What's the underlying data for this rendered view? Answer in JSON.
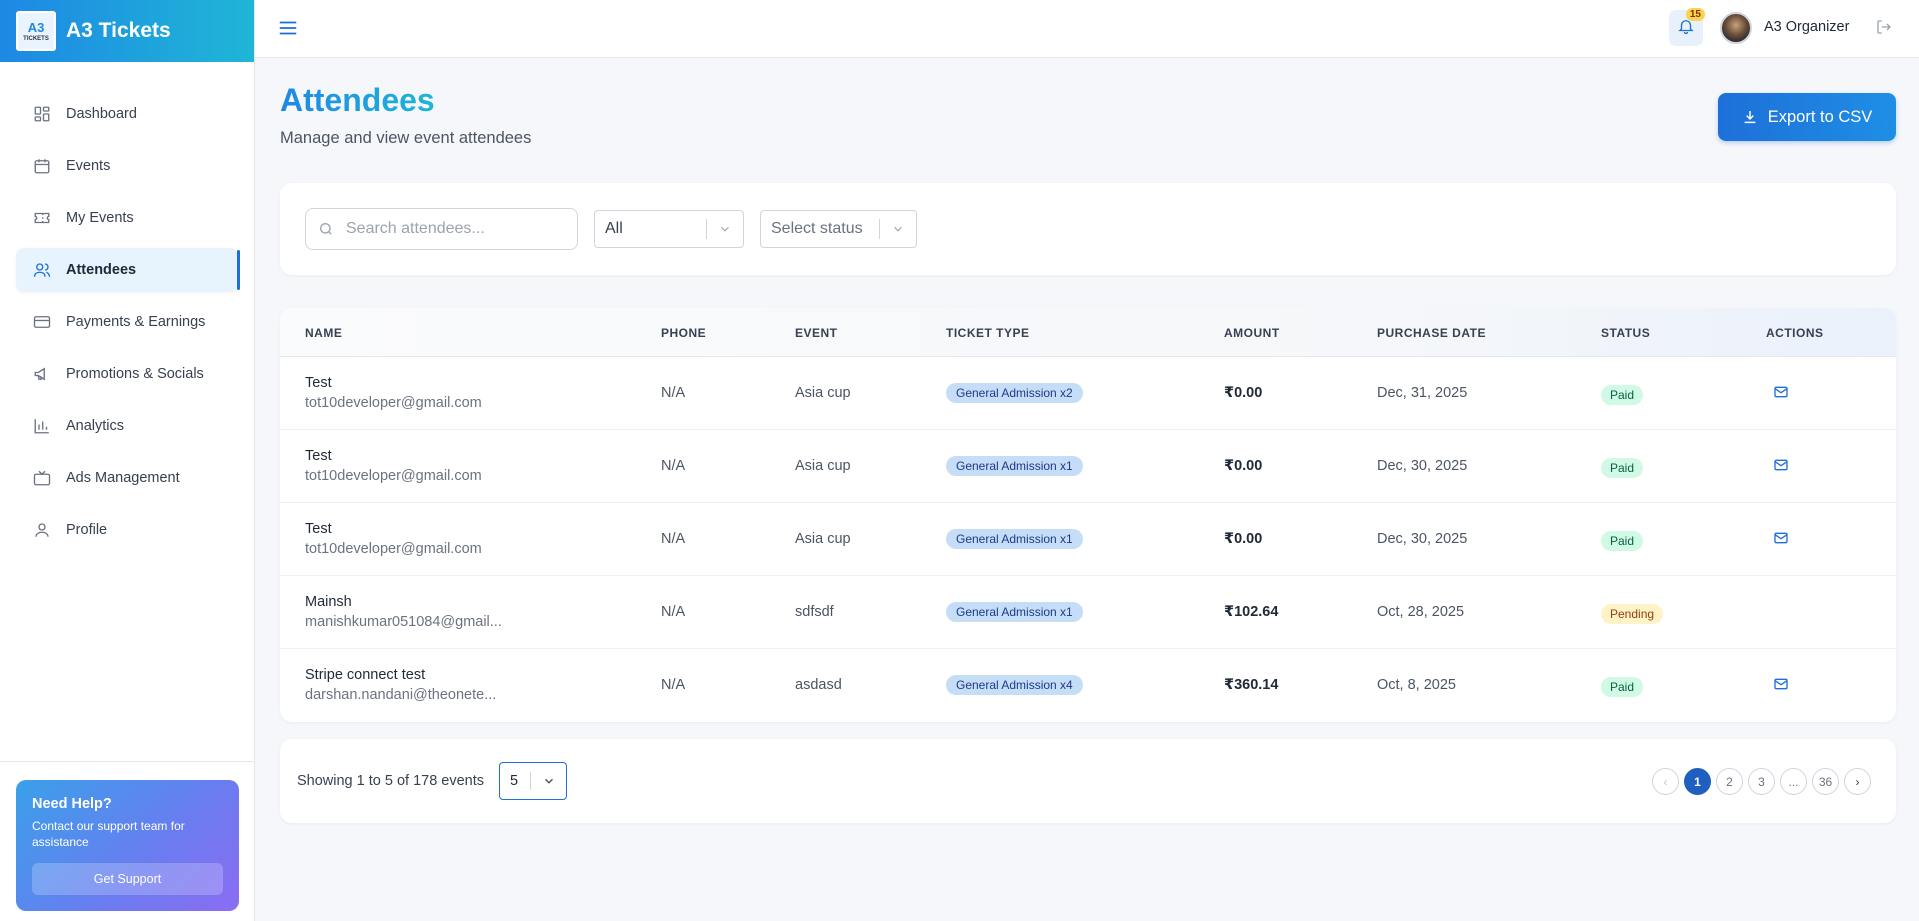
{
  "brand": {
    "title": "A3 Tickets",
    "logo_text": "A3",
    "logo_small": "TICKETS"
  },
  "sidebar": {
    "items": [
      {
        "label": "Dashboard",
        "icon": "dashboard-icon"
      },
      {
        "label": "Events",
        "icon": "calendar-icon"
      },
      {
        "label": "My Events",
        "icon": "ticket-icon"
      },
      {
        "label": "Attendees",
        "icon": "users-icon",
        "active": true
      },
      {
        "label": "Payments & Earnings",
        "icon": "credit-card-icon"
      },
      {
        "label": "Promotions & Socials",
        "icon": "megaphone-icon"
      },
      {
        "label": "Analytics",
        "icon": "bar-chart-icon"
      },
      {
        "label": "Ads Management",
        "icon": "tv-icon"
      },
      {
        "label": "Profile",
        "icon": "user-icon"
      }
    ],
    "help": {
      "title": "Need Help?",
      "text": "Contact our support team for assistance",
      "button": "Get Support"
    }
  },
  "topbar": {
    "notification_count": "15",
    "user_name": "A3 Organizer"
  },
  "page": {
    "title": "Attendees",
    "subtitle": "Manage and view event attendees",
    "export_label": "Export to CSV"
  },
  "filters": {
    "search_placeholder": "Search attendees...",
    "type_value": "All",
    "status_placeholder": "Select status"
  },
  "table": {
    "headers": {
      "name": "NAME",
      "phone": "PHONE",
      "event": "EVENT",
      "ticket_type": "TICKET TYPE",
      "amount": "AMOUNT",
      "purchase_date": "PURCHASE DATE",
      "status": "STATUS",
      "actions": "ACTIONS"
    },
    "rows": [
      {
        "name": "Test",
        "email": "tot10developer@gmail.com",
        "phone": "N/A",
        "event": "Asia cup",
        "ticket": "General Admission x2",
        "amount": "₹0.00",
        "date": "Dec, 31, 2025",
        "status": "Paid",
        "mail": true
      },
      {
        "name": "Test",
        "email": "tot10developer@gmail.com",
        "phone": "N/A",
        "event": "Asia cup",
        "ticket": "General Admission x1",
        "amount": "₹0.00",
        "date": "Dec, 30, 2025",
        "status": "Paid",
        "mail": true
      },
      {
        "name": "Test",
        "email": "tot10developer@gmail.com",
        "phone": "N/A",
        "event": "Asia cup",
        "ticket": "General Admission x1",
        "amount": "₹0.00",
        "date": "Dec, 30, 2025",
        "status": "Paid",
        "mail": true
      },
      {
        "name": "Mainsh",
        "email": "manishkumar051084@gmail...",
        "phone": "N/A",
        "event": "sdfsdf",
        "ticket": "General Admission x1",
        "amount": "₹102.64",
        "date": "Oct, 28, 2025",
        "status": "Pending",
        "mail": false
      },
      {
        "name": "Stripe connect test",
        "email": "darshan.nandani@theonete...",
        "phone": "N/A",
        "event": "asdasd",
        "ticket": "General Admission x4",
        "amount": "₹360.14",
        "date": "Oct, 8, 2025",
        "status": "Paid",
        "mail": true
      }
    ]
  },
  "pagination": {
    "showing_text": "Showing 1 to 5 of 178 events",
    "per_page": "5",
    "prev_label": "‹",
    "next_label": "›",
    "pages": [
      "1",
      "2",
      "3",
      "...",
      "36"
    ],
    "current": "1"
  },
  "colors": {
    "accent": "#1e6fd9",
    "brand_gradient_start": "#1e88e5",
    "brand_gradient_end": "#1fb6d6",
    "paid": "#d1fae5",
    "pending": "#fef3c7",
    "ticket_badge": "#c5ddf7"
  }
}
